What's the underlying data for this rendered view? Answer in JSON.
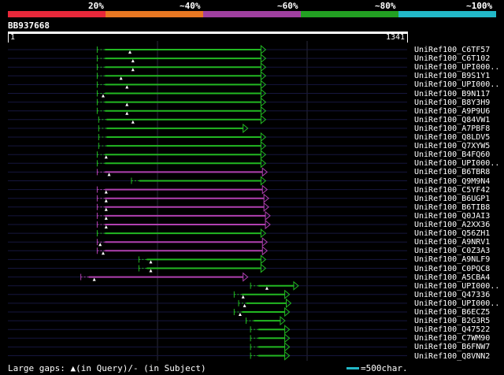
{
  "scale": {
    "labels": [
      "20%",
      "~40%",
      "~60%",
      "~80%",
      "~100%"
    ],
    "colors": [
      "#e8283a",
      "#e87722",
      "#a040a0",
      "#22a022",
      "#22b8c8"
    ]
  },
  "query": {
    "name": "BB937668",
    "start": "1",
    "end": "1341",
    "length": 1341
  },
  "colors": {
    "green": "#22b822",
    "magenta": "#b040b0",
    "bg": "#000000",
    "guide": "#16163e",
    "gap": "#ffffff"
  },
  "chart_data": {
    "type": "alignment",
    "query_length": 1341,
    "hits": [
      {
        "name": "UniRef100_C6TF57",
        "start": 300,
        "end": 850,
        "color": "green",
        "gap": 410
      },
      {
        "name": "UniRef100_C6T102",
        "start": 300,
        "end": 850,
        "color": "green",
        "gap": 420
      },
      {
        "name": "UniRef100_UPI000..",
        "start": 300,
        "end": 850,
        "color": "green",
        "gap": 420
      },
      {
        "name": "UniRef100_B9S1Y1",
        "start": 300,
        "end": 850,
        "color": "green",
        "gap": 380
      },
      {
        "name": "UniRef100_UPI000..",
        "start": 300,
        "end": 850,
        "color": "green",
        "gap": 400
      },
      {
        "name": "UniRef100_B9N117",
        "start": 300,
        "end": 850,
        "color": "green",
        "gap": 320
      },
      {
        "name": "UniRef100_B8Y3H9",
        "start": 300,
        "end": 850,
        "color": "green",
        "gap": 400
      },
      {
        "name": "UniRef100_A9P9U6",
        "start": 300,
        "end": 850,
        "color": "green",
        "gap": 400
      },
      {
        "name": "UniRef100_Q84VW1",
        "start": 305,
        "end": 850,
        "color": "green",
        "gap": 420
      },
      {
        "name": "UniRef100_A7PBF8",
        "start": 305,
        "end": 790,
        "color": "green",
        "gap": null
      },
      {
        "name": "UniRef100_Q8LDV5",
        "start": 305,
        "end": 850,
        "color": "green",
        "gap": null
      },
      {
        "name": "UniRef100_Q7XYW5",
        "start": 305,
        "end": 850,
        "color": "green",
        "gap": null
      },
      {
        "name": "UniRef100_B4FQ60",
        "start": 300,
        "end": 850,
        "color": "green",
        "gap": 330
      },
      {
        "name": "UniRef100_UPI000..",
        "start": 300,
        "end": 850,
        "color": "green",
        "gap": null
      },
      {
        "name": "UniRef100_B6TBR8",
        "start": 300,
        "end": 855,
        "color": "magenta",
        "gap": 340
      },
      {
        "name": "UniRef100_Q9M9N4",
        "start": 415,
        "end": 850,
        "color": "green",
        "gap": null
      },
      {
        "name": "UniRef100_C5YF42",
        "start": 300,
        "end": 855,
        "color": "magenta",
        "gap": 330
      },
      {
        "name": "UniRef100_B6UGP1",
        "start": 300,
        "end": 860,
        "color": "magenta",
        "gap": 330
      },
      {
        "name": "UniRef100_B6TIB8",
        "start": 300,
        "end": 860,
        "color": "magenta",
        "gap": 330
      },
      {
        "name": "UniRef100_Q0JAI3",
        "start": 300,
        "end": 865,
        "color": "magenta",
        "gap": 330
      },
      {
        "name": "UniRef100_A2XX36",
        "start": 300,
        "end": 865,
        "color": "magenta",
        "gap": 330
      },
      {
        "name": "UniRef100_Q56ZH1",
        "start": 300,
        "end": 850,
        "color": "green",
        "gap": null
      },
      {
        "name": "UniRef100_A9NRV1",
        "start": 300,
        "end": 855,
        "color": "magenta",
        "gap": 310
      },
      {
        "name": "UniRef100_C0Z3A3",
        "start": 300,
        "end": 855,
        "color": "magenta",
        "gap": 320
      },
      {
        "name": "UniRef100_A9NLF9",
        "start": 440,
        "end": 850,
        "color": "green",
        "gap": 480
      },
      {
        "name": "UniRef100_C0PQC8",
        "start": 440,
        "end": 850,
        "color": "green",
        "gap": 480
      },
      {
        "name": "UniRef100_A5CBA4",
        "start": 245,
        "end": 790,
        "color": "magenta",
        "gap": 290
      },
      {
        "name": "UniRef100_UPI000..",
        "start": 815,
        "end": 960,
        "color": "green",
        "gap": 870
      },
      {
        "name": "UniRef100_Q47336",
        "start": 760,
        "end": 930,
        "color": "green",
        "gap": 790
      },
      {
        "name": "UniRef100_UPI000..",
        "start": 775,
        "end": 935,
        "color": "green",
        "gap": 795
      },
      {
        "name": "UniRef100_B6ECZ5",
        "start": 760,
        "end": 930,
        "color": "green",
        "gap": 780
      },
      {
        "name": "UniRef100_B2G3R5",
        "start": 800,
        "end": 915,
        "color": "green",
        "gap": null
      },
      {
        "name": "UniRef100_Q47522",
        "start": 815,
        "end": 930,
        "color": "green",
        "gap": null
      },
      {
        "name": "UniRef100_C7WM90",
        "start": 815,
        "end": 930,
        "color": "green",
        "gap": null
      },
      {
        "name": "UniRef100_B6FNW7",
        "start": 815,
        "end": 930,
        "color": "green",
        "gap": null
      },
      {
        "name": "UniRef100_Q8VNN2",
        "start": 815,
        "end": 930,
        "color": "green",
        "gap": null
      }
    ]
  },
  "footer": {
    "gaps_text": "Large gaps: ▲(in Query)/- (in Subject)",
    "legend_text": "=500char.",
    "legend_color": "#22b8c8"
  }
}
